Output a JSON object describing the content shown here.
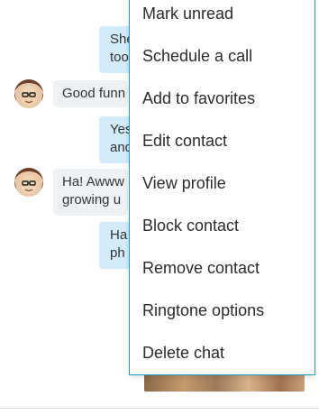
{
  "messages": [
    {
      "side": "out",
      "text": "She"
    },
    {
      "side": "out",
      "text": "too"
    },
    {
      "side": "in",
      "text": "Good funn"
    },
    {
      "side": "out",
      "text": "Yes"
    },
    {
      "side": "out",
      "text": "and"
    },
    {
      "side": "in",
      "text": "Ha! Awww"
    },
    {
      "side": "in",
      "text": "growing u"
    },
    {
      "side": "out",
      "text": "Ha"
    },
    {
      "side": "out",
      "text": "ph"
    }
  ],
  "menu": {
    "items": [
      {
        "label": "Mark unread"
      },
      {
        "label": "Schedule a call"
      },
      {
        "label": "Add to favorites"
      },
      {
        "label": "Edit contact"
      },
      {
        "label": "View profile"
      },
      {
        "label": "Block contact"
      },
      {
        "label": "Remove contact"
      },
      {
        "label": "Ringtone options"
      },
      {
        "label": "Delete chat"
      }
    ]
  },
  "colors": {
    "outgoing_bubble": "#d3ecfb",
    "incoming_bubble": "#eef2f5",
    "menu_border": "#1d9bd9"
  }
}
